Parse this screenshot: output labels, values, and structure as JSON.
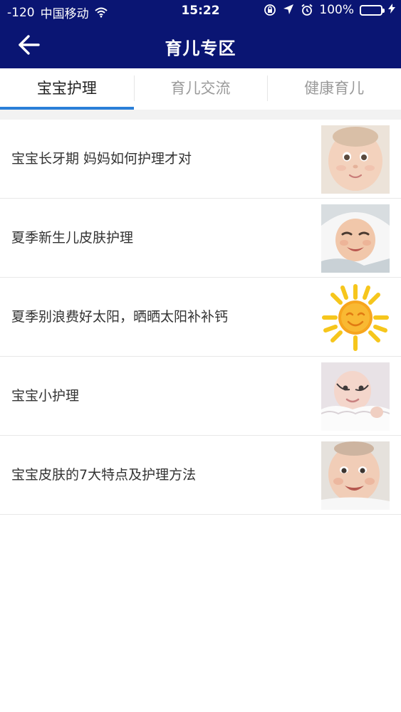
{
  "status_bar": {
    "signal": "-120",
    "carrier": "中国移动",
    "wifi_icon": "wifi-icon",
    "time": "15:22",
    "battery_percent": "100%",
    "battery_level": 1.0
  },
  "nav": {
    "title": "育儿专区",
    "back_icon": "arrow-left-icon"
  },
  "tabs": [
    {
      "label": "宝宝护理",
      "active": true
    },
    {
      "label": "育儿交流",
      "active": false
    },
    {
      "label": "健康育儿",
      "active": false
    }
  ],
  "articles": [
    {
      "title": "宝宝长牙期 妈妈如何护理才对",
      "thumb": "baby-face-photo"
    },
    {
      "title": "夏季新生儿皮肤护理",
      "thumb": "baby-in-hood-photo"
    },
    {
      "title": "夏季别浪费好太阳，晒晒太阳补补钙",
      "thumb": "sun-drawing"
    },
    {
      "title": "宝宝小护理",
      "thumb": "baby-in-lace-photo"
    },
    {
      "title": "宝宝皮肤的7大特点及护理方法",
      "thumb": "baby-smiling-photo"
    }
  ],
  "colors": {
    "header_bg": "#0a1573",
    "tab_indicator": "#2b7fd8",
    "battery_fill": "#4cd964"
  }
}
